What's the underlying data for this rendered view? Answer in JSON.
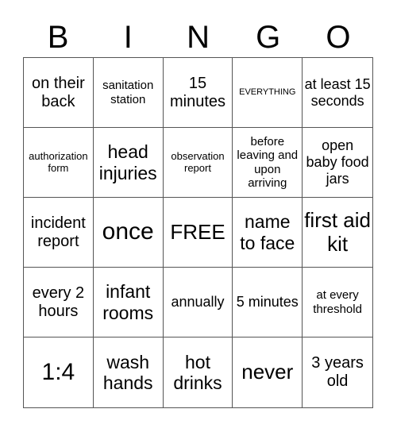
{
  "header": {
    "letters": [
      "B",
      "I",
      "N",
      "G",
      "O"
    ]
  },
  "cells": [
    {
      "text": "on their back",
      "size": "ml"
    },
    {
      "text": "sanitation station",
      "size": "sm"
    },
    {
      "text": "15 minutes",
      "size": "ml"
    },
    {
      "text": "EVERYTHING",
      "size": "xs"
    },
    {
      "text": "at least 15 seconds",
      "size": "m"
    },
    {
      "text": "authorization form",
      "size": "s"
    },
    {
      "text": "head injuries",
      "size": "l"
    },
    {
      "text": "observation report",
      "size": "s"
    },
    {
      "text": "before leaving and upon arriving",
      "size": "sm"
    },
    {
      "text": "open baby food jars",
      "size": "m"
    },
    {
      "text": "incident report",
      "size": "ml"
    },
    {
      "text": "once",
      "size": "xxl"
    },
    {
      "text": "FREE",
      "size": "xl"
    },
    {
      "text": "name to face",
      "size": "l"
    },
    {
      "text": "first aid kit",
      "size": "xl"
    },
    {
      "text": "every 2 hours",
      "size": "ml"
    },
    {
      "text": "infant rooms",
      "size": "l"
    },
    {
      "text": "annually",
      "size": "m"
    },
    {
      "text": "5 minutes",
      "size": "m"
    },
    {
      "text": "at every threshold",
      "size": "sm"
    },
    {
      "text": "1:4",
      "size": "xxl"
    },
    {
      "text": "wash hands",
      "size": "l"
    },
    {
      "text": "hot drinks",
      "size": "l"
    },
    {
      "text": "never",
      "size": "xl"
    },
    {
      "text": "3 years old",
      "size": "ml"
    }
  ]
}
